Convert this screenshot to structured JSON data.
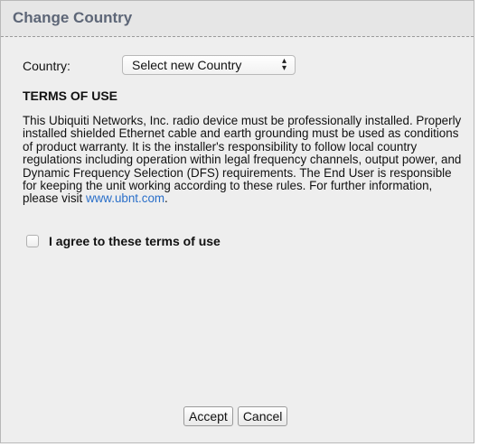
{
  "dialog": {
    "title": "Change Country"
  },
  "country": {
    "label": "Country:",
    "selected": "Select new Country",
    "arrows_icon": "updown-arrows-icon"
  },
  "terms": {
    "heading": "TERMS OF USE",
    "body": "This Ubiquiti Networks, Inc. radio device must be professionally installed. Properly installed shielded Ethernet cable and earth grounding must be used as conditions of product warranty. It is the installer's responsibility to follow local country regulations including operation within legal frequency channels, output power, and Dynamic Frequency Selection (DFS) requirements. The End User is responsible for keeping the unit working according to these rules. For further information, please visit ",
    "link_text": "www.ubnt.com",
    "after_link": "."
  },
  "agree": {
    "label": "I agree to these terms of use",
    "checked": false
  },
  "buttons": {
    "accept_label": "Accept",
    "cancel_label": "Cancel"
  },
  "colors": {
    "title_text": "#5d6677",
    "link": "#2a6fc9",
    "dialog_background": "#eeeeee"
  }
}
